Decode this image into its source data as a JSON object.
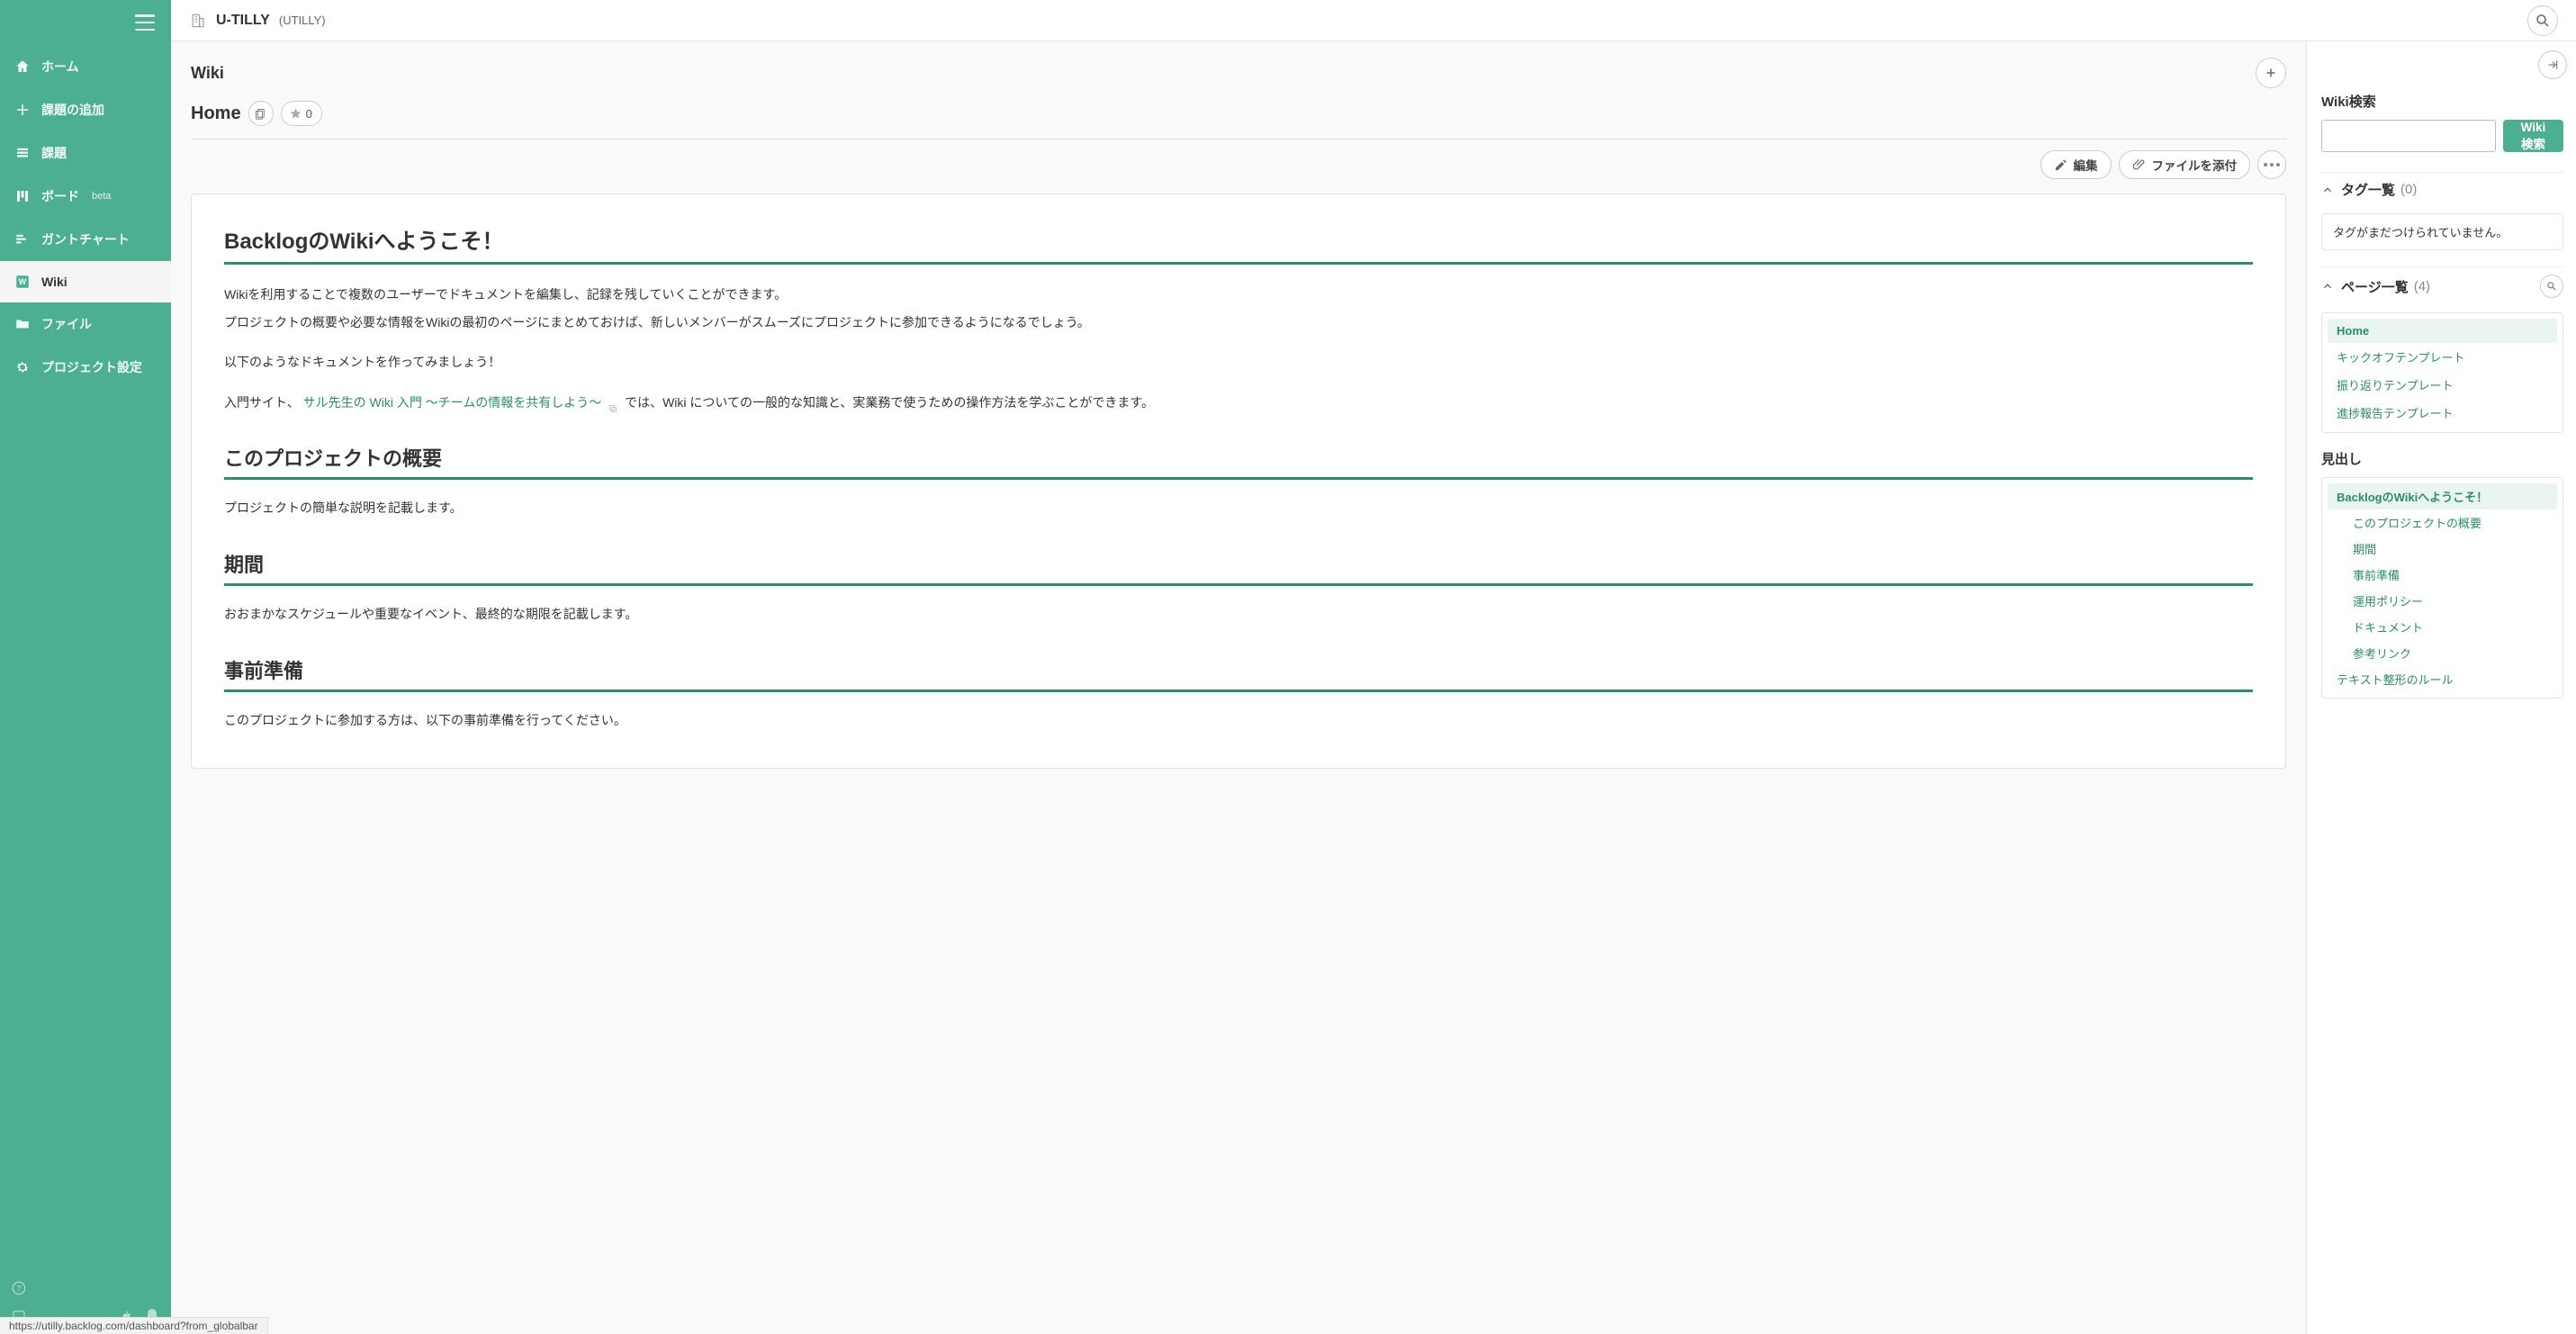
{
  "sidebar": {
    "items": [
      {
        "label": "ホーム",
        "icon": "home"
      },
      {
        "label": "課題の追加",
        "icon": "plus"
      },
      {
        "label": "課題",
        "icon": "list"
      },
      {
        "label": "ボード",
        "icon": "board",
        "beta": "beta"
      },
      {
        "label": "ガントチャート",
        "icon": "gantt"
      },
      {
        "label": "Wiki",
        "icon": "wiki",
        "active": true
      },
      {
        "label": "ファイル",
        "icon": "folder"
      },
      {
        "label": "プロジェクト設定",
        "icon": "gear"
      }
    ]
  },
  "header": {
    "project_name": "U-TILLY",
    "project_code": "(UTILLY)"
  },
  "wiki": {
    "section": "Wiki",
    "page_title": "Home",
    "star_count": "0",
    "edit_label": "編集",
    "attach_label": "ファイルを添付",
    "body": {
      "h1": "BacklogのWikiへようこそ！",
      "p1a": "Wikiを利用することで複数のユーザーでドキュメントを編集し、記録を残していくことができます。",
      "p1b": "プロジェクトの概要や必要な情報をWikiの最初のページにまとめておけば、新しいメンバーがスムーズにプロジェクトに参加できるようになるでしょう。",
      "p2": "以下のようなドキュメントを作ってみましょう！",
      "p3a": "入門サイト、",
      "p3link": "サル先生の Wiki 入門 〜チームの情報を共有しよう〜",
      "p3b": "では、Wiki についての一般的な知識と、実業務で使うための操作方法を学ぶことができます。",
      "h2a": "このプロジェクトの概要",
      "p4": "プロジェクトの簡単な説明を記載します。",
      "h2b": "期間",
      "p5": "おおまかなスケジュールや重要なイベント、最終的な期限を記載します。",
      "h2c": "事前準備",
      "p6": "このプロジェクトに参加する方は、以下の事前準備を行ってください。"
    }
  },
  "right": {
    "search_title": "Wiki検索",
    "search_button": "Wiki検索",
    "tags_title": "タグ一覧",
    "tags_count": "(0)",
    "tags_empty": "タグがまだつけられていません。",
    "pages_title": "ページ一覧",
    "pages_count": "(4)",
    "pages": [
      {
        "label": "Home",
        "active": true
      },
      {
        "label": "キックオフテンプレート"
      },
      {
        "label": "振り返りテンプレート"
      },
      {
        "label": "進捗報告テンプレート"
      }
    ],
    "headings_title": "見出し",
    "toc": [
      {
        "label": "BacklogのWikiへようこそ！",
        "active": true,
        "indent": false
      },
      {
        "label": "このプロジェクトの概要",
        "indent": true
      },
      {
        "label": "期間",
        "indent": true
      },
      {
        "label": "事前準備",
        "indent": true
      },
      {
        "label": "運用ポリシー",
        "indent": true
      },
      {
        "label": "ドキュメント",
        "indent": true
      },
      {
        "label": "参考リンク",
        "indent": true
      },
      {
        "label": "テキスト整形のルール",
        "indent": false
      }
    ]
  },
  "status_url": "https://utilly.backlog.com/dashboard?from_globalbar"
}
